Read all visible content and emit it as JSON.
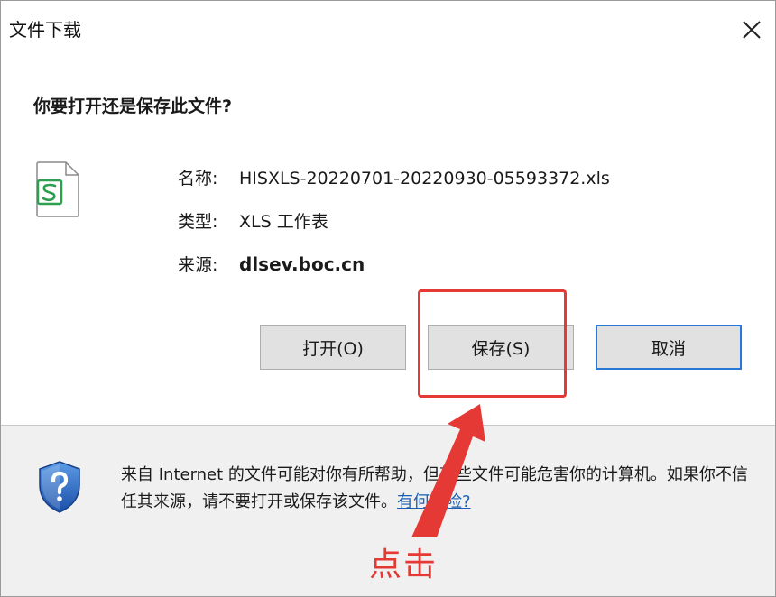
{
  "window": {
    "title": "文件下载",
    "close_icon": "close-icon"
  },
  "main": {
    "question": "你要打开还是保存此文件?",
    "file_icon": "xls-file-icon",
    "fields": {
      "name_label": "名称:",
      "name_value": "HISXLS-20220701-20220930-05593372.xls",
      "type_label": "类型:",
      "type_value": "XLS 工作表",
      "source_label": "来源:",
      "source_value": "dlsev.boc.cn"
    },
    "buttons": {
      "open_label": "打开(O)",
      "save_label": "保存(S)",
      "cancel_label": "取消"
    }
  },
  "footer": {
    "shield_icon": "security-shield-icon",
    "warning_text": "来自 Internet 的文件可能对你有所帮助，但某些文件可能危害你的计算机。如果你不信任其来源，请不要打开或保存该文件。",
    "risk_link": "有何风险?"
  },
  "annotation": {
    "label": "点击",
    "color": "#e53935"
  },
  "colors": {
    "accent_border": "#2a78d6",
    "link": "#1a5fb4",
    "highlight": "#e53935"
  }
}
